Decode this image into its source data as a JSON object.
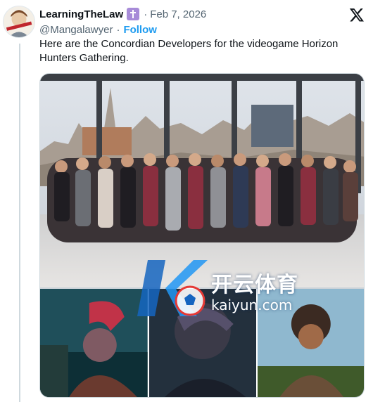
{
  "post": {
    "display_name": "LearningTheLaw",
    "badge_icon": "cross-badge-icon",
    "date": "Feb 7, 2026",
    "separator_dot": "·",
    "handle": "@Mangalawyer",
    "handle_separator": "·",
    "follow_label": "Follow",
    "text": "Here are the Concordian Developers for the videogame Horizon Hunters Gathering."
  },
  "watermark": {
    "brand_cn": "开云体育",
    "brand_en": "kaiyun.com"
  },
  "colors": {
    "accent": "#1d9bf0",
    "text_primary": "#0f1419",
    "text_secondary": "#536471",
    "badge": "#a78bd8"
  }
}
